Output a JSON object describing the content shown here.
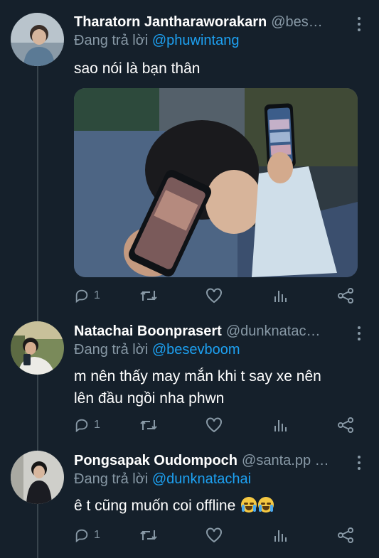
{
  "tweets": [
    {
      "name": "Tharatorn Jantharaworakarn",
      "handle": "@bes…",
      "reply_prefix": "Đang trả lời ",
      "reply_to": "@phuwintang",
      "text": "sao nói là bạn thân",
      "has_media": true,
      "actions": {
        "reply_count": "1",
        "retweet_count": "",
        "like_count": ""
      }
    },
    {
      "name": "Natachai Boonprasert",
      "handle": "@dunknatac…",
      "reply_prefix": "Đang trả lời ",
      "reply_to": "@besevboom",
      "text": "m nên thấy may mắn khi t say xe nên lên đầu ngồi nha phwn",
      "actions": {
        "reply_count": "1",
        "retweet_count": "",
        "like_count": ""
      }
    },
    {
      "name": "Pongsapak Oudompoch",
      "handle": "@santa.pp …",
      "reply_prefix": "Đang trả lời ",
      "reply_to": "@dunknatachai",
      "text": "ê t cũng muốn coi offline",
      "emoji": [
        "loudly-crying-face",
        "loudly-crying-face"
      ],
      "actions": {
        "reply_count": "1",
        "retweet_count": "",
        "like_count": ""
      }
    }
  ],
  "colors": {
    "background": "#15202b",
    "secondary_text": "#8899a6",
    "mention": "#1da1f2",
    "thread_line": "#38444d"
  }
}
